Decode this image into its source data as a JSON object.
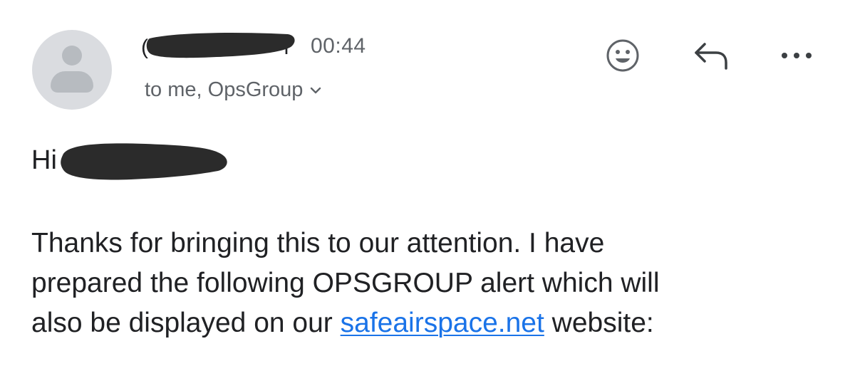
{
  "header": {
    "sender_first_char": "(",
    "sender_last_char": "f",
    "time": "00:44",
    "recipients": "to me, OpsGroup"
  },
  "icons": {
    "avatar": "person-avatar-icon",
    "recipients_expand": "chevron-down-icon",
    "emoji": "smiley-face-icon",
    "reply": "reply-arrow-icon",
    "more": "more-horizontal-icon"
  },
  "message": {
    "greeting": "Hi",
    "line1": "Thanks for bringing this to our attention. I have",
    "line2": "prepared the following OPSGROUP alert which will",
    "line3_before": "also be displayed on our ",
    "line3_link": "safeairspace.net",
    "line3_after": " website:"
  },
  "colors": {
    "link": "#1a73e8",
    "secondary_text": "#5f6368",
    "redaction": "#2b2b2b",
    "avatar_bg": "#dadce0"
  }
}
